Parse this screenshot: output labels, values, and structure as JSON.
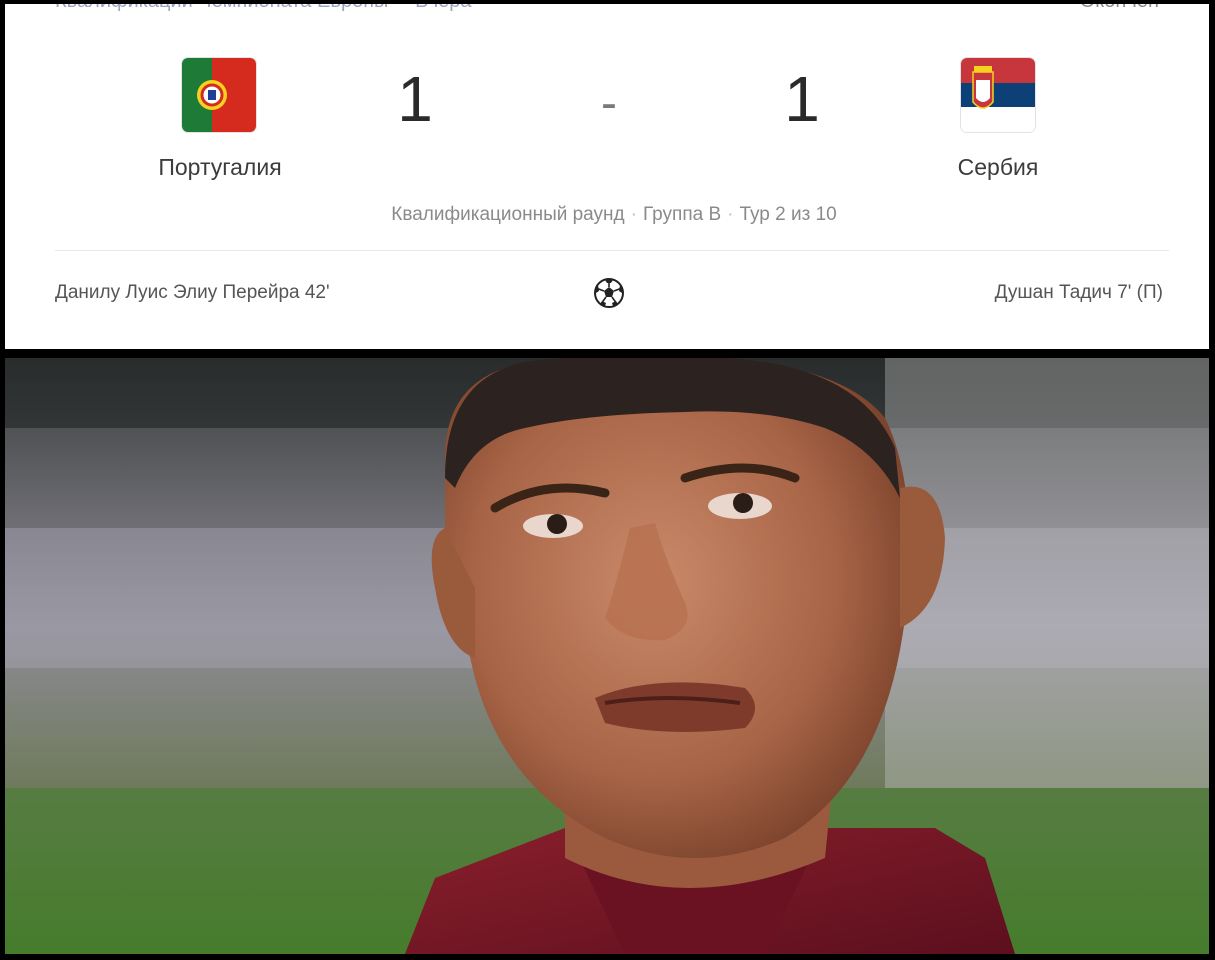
{
  "match_card": {
    "header": {
      "competition": "Квалификации Чемпионата Европы",
      "date": "Вчера",
      "status": "Окончен"
    },
    "home_team": {
      "name": "Португалия",
      "flag_icon": "portugal-flag-icon"
    },
    "away_team": {
      "name": "Сербия",
      "flag_icon": "serbia-flag-icon"
    },
    "score": {
      "home": "1",
      "separator": "-",
      "away": "1"
    },
    "round_info": {
      "round": "Квалификационный раунд",
      "group": "Группа B",
      "matchday": "Тур 2 из 10"
    },
    "scorers": {
      "home": "Данилу Луис Элиу Перейра 42'",
      "goal_icon": "soccer-ball-icon",
      "away": "Душан Тадич 7' (П)"
    }
  },
  "colors": {
    "card_bg": "#ffffff",
    "border": "#000000",
    "portugal_green": "#1e7a37",
    "portugal_red": "#d52b1e",
    "serbia_red": "#c6363c",
    "serbia_blue": "#0c4076",
    "serbia_white": "#ffffff"
  }
}
